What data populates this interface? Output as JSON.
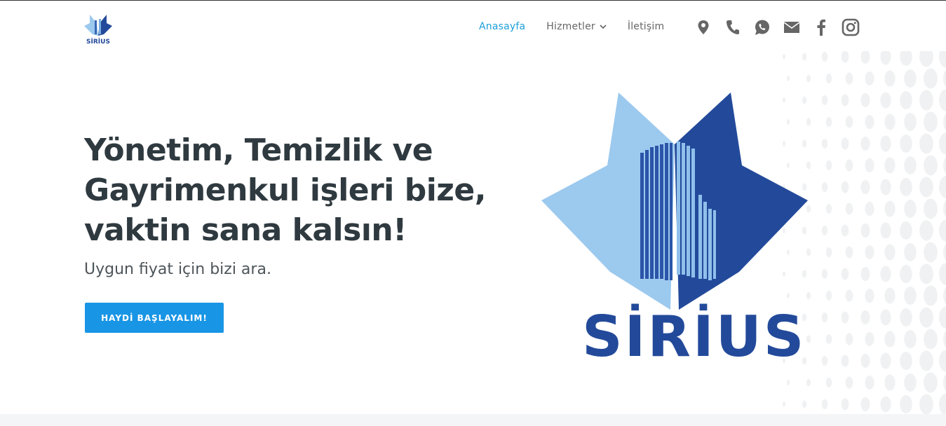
{
  "brand": {
    "name": "SİRİUS",
    "small_logo_text": "SİRİUS"
  },
  "nav": {
    "items": [
      {
        "label": "Anasayfa",
        "active": true
      },
      {
        "label": "Hizmetler",
        "dropdown": true
      },
      {
        "label": "İletişim"
      }
    ]
  },
  "social": {
    "icons": [
      "location-pin-icon",
      "phone-icon",
      "whatsapp-icon",
      "mail-icon",
      "facebook-icon",
      "instagram-icon"
    ]
  },
  "hero": {
    "title_line1": "Yönetim, Temizlik ve",
    "title_line2": "Gayrimenkul işleri bize,",
    "title_line3": "vaktin sana kalsın!",
    "subtitle": "Uygun fiyat için bizi ara.",
    "cta_label": "HAYDİ BAŞLAYALIM!"
  },
  "colors": {
    "accent": "#1e9fd8",
    "button": "#1995e5",
    "brand_dark": "#234a9a",
    "brand_light": "#9cc9ee",
    "heading": "#2f3a40"
  }
}
